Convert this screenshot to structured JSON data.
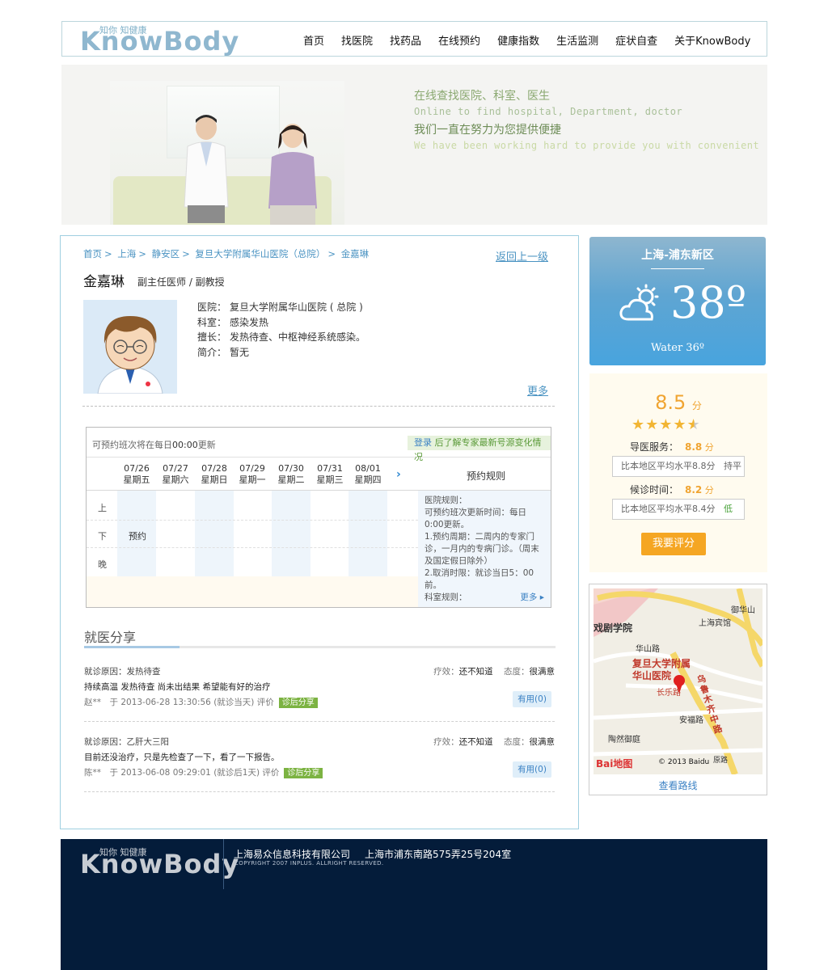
{
  "header": {
    "logo_cn": "知你 知健康",
    "logo_en": "KnowBody",
    "nav": [
      "首页",
      "找医院",
      "找药品",
      "在线预约",
      "健康指数",
      "生活监测",
      "症状自查",
      "关于KnowBody"
    ]
  },
  "banner": {
    "line1": "在线查找医院、科室、医生",
    "line2": "Online to find hospital, Department, doctor",
    "line3": "我们一直在努力为您提供便捷",
    "line4": "We have been working hard to provide you with convenient"
  },
  "breadcrumb": [
    "首页",
    "上海",
    "静安区",
    "复旦大学附属华山医院（总院）",
    "金嘉琳"
  ],
  "back_link": "返回上一级",
  "doctor": {
    "name": "金嘉琳",
    "title": "副主任医师 / 副教授",
    "info": [
      {
        "label": "医院：",
        "value": "复旦大学附属华山医院 ( 总院 )"
      },
      {
        "label": "科室：",
        "value": "感染发热"
      },
      {
        "label": "擅长：",
        "value": "发热待查、中枢神经系统感染。"
      },
      {
        "label": "简介：",
        "value": "暂无"
      }
    ],
    "more": "更多"
  },
  "schedule": {
    "note_prefix": "可预约班次将在每日",
    "note_time": "00:00",
    "note_suffix": "更新",
    "login": "登录",
    "login_suffix": "后了解专家最新号源变化情况",
    "days": [
      {
        "date": "07/26",
        "week": "星期五"
      },
      {
        "date": "07/27",
        "week": "星期六"
      },
      {
        "date": "07/28",
        "week": "星期日"
      },
      {
        "date": "07/29",
        "week": "星期一"
      },
      {
        "date": "07/30",
        "week": "星期二"
      },
      {
        "date": "07/31",
        "week": "星期三"
      },
      {
        "date": "08/01",
        "week": "星期四"
      }
    ],
    "next_arrow": "›",
    "rules_header": "预约规则",
    "rows": [
      "上",
      "下",
      "晚"
    ],
    "book_label": "预约",
    "rules_text": [
      "医院规则：",
      "可预约班次更新时间：每日0:00更新。",
      "1.预约周期：二周内的专家门诊，一月内的专病门诊。（周末及国定假日除外）",
      "2.取消时限：就诊当日5：00前。",
      "科室规则："
    ],
    "rules_more": "更多 ▸"
  },
  "shares": {
    "heading": "就医分享",
    "items": [
      {
        "reason": "就诊原因：发热待查",
        "effect_label": "疗效：",
        "effect": "还不知道",
        "attitude_label": "态度：",
        "attitude": "很满意",
        "content": "持续高温 发热待查 尚未出结果 希望能有好的治疗",
        "meta": "赵**　于 2013-06-28 13:30:56 (就诊当天) 评价",
        "tag": "诊后分享",
        "useful": "有用(0)"
      },
      {
        "reason": "就诊原因：乙肝大三阳",
        "effect_label": "疗效：",
        "effect": "还不知道",
        "attitude_label": "态度：",
        "attitude": "很满意",
        "content": "目前还没治疗，只是先检查了一下，看了一下报告。",
        "meta": "陈**　于 2013-06-08 09:29:01 (就诊后1天) 评价",
        "tag": "诊后分享",
        "useful": "有用(0)"
      }
    ]
  },
  "weather": {
    "city": "上海-浦东新区",
    "temp": "38º",
    "water": "Water 36º",
    "icon": "partly-cloudy-icon"
  },
  "rating": {
    "score": "8.5",
    "unit": "分",
    "stars": 4.5,
    "service_label": "导医服务：",
    "service_score": "8.8",
    "service_compare": "比本地区平均水平8.8分",
    "service_level": "持平",
    "wait_label": "候诊时间：",
    "wait_score": "8.2",
    "wait_compare": "比本地区平均水平8.4分",
    "wait_level": "低",
    "button": "我要评分"
  },
  "map": {
    "labels": [
      "御华山",
      "上海宾馆",
      "戏剧学院",
      "华山路",
      "复旦大学附属华山医院",
      "长乐路",
      "乌鲁木齐中路",
      "安福路",
      "陶然御庭",
      "© 2013 Baidu",
      "原路"
    ],
    "route_link": "查看路线",
    "brand": "Bai地图"
  },
  "footer": {
    "company": "上海易众信息科技有限公司",
    "address": "上海市浦东南路575弄25号204室",
    "copyright": "COPYRIGHT 2007 INPLUS. ALLRIGHT RESERVED."
  },
  "colors": {
    "accent_blue": "#4a93c2",
    "footer_bg": "#041c3a",
    "orange": "#f5a623"
  }
}
